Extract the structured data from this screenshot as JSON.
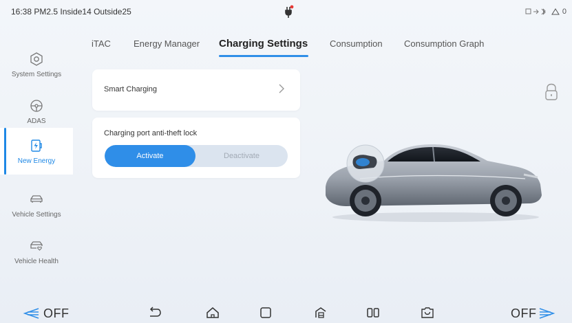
{
  "status_bar": {
    "info": "16:38 PM2.5 Inside14 Outside25",
    "right_text": "0"
  },
  "sidebar": {
    "items": [
      {
        "label": "System Settings",
        "icon": "settings-hex-icon",
        "active": false
      },
      {
        "label": "ADAS",
        "icon": "steering-wheel-icon",
        "active": false
      },
      {
        "label": "New Energy",
        "icon": "charging-icon",
        "active": true
      },
      {
        "label": "Vehicle Settings",
        "icon": "car-icon",
        "active": false
      },
      {
        "label": "Vehicle Health",
        "icon": "car-health-icon",
        "active": false
      }
    ]
  },
  "tabs": [
    {
      "label": "iTAC",
      "active": false
    },
    {
      "label": "Energy Manager",
      "active": false
    },
    {
      "label": "Charging Settings",
      "active": true
    },
    {
      "label": "Consumption",
      "active": false
    },
    {
      "label": "Consumption Graph",
      "active": false
    }
  ],
  "smart_charging": {
    "label": "Smart Charging"
  },
  "anti_theft": {
    "label": "Charging port anti-theft lock",
    "options": [
      "Activate",
      "Deactivate"
    ],
    "selected": "Activate"
  },
  "bottom_bar": {
    "left_ac": "OFF",
    "right_ac": "OFF"
  },
  "colors": {
    "accent": "#2f8ee8",
    "background": "#eef2f7"
  }
}
